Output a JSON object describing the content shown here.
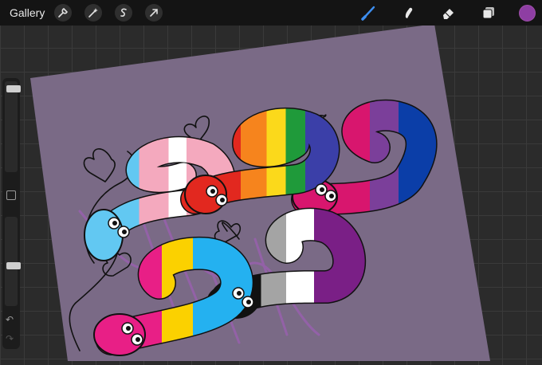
{
  "toolbar": {
    "gallery_label": "Gallery",
    "left_tools": [
      "wrench-icon",
      "magic-wand-icon",
      "selection-s-icon",
      "transform-arrow-icon"
    ],
    "right_tools": [
      "brush-icon",
      "smudge-icon",
      "eraser-icon",
      "layers-icon"
    ],
    "active_tool": "brush-icon",
    "active_tool_color": "#3d8ef0",
    "current_color": "#8e3ea3"
  },
  "sidebar": {
    "brush_size_level": 0.05,
    "opacity_level": 0.55,
    "undo_icon": "undo-icon",
    "redo_icon": "redo-icon"
  },
  "canvas": {
    "background_color": "#7a6a86",
    "artwork": "rainbow-snakes-drawing"
  }
}
